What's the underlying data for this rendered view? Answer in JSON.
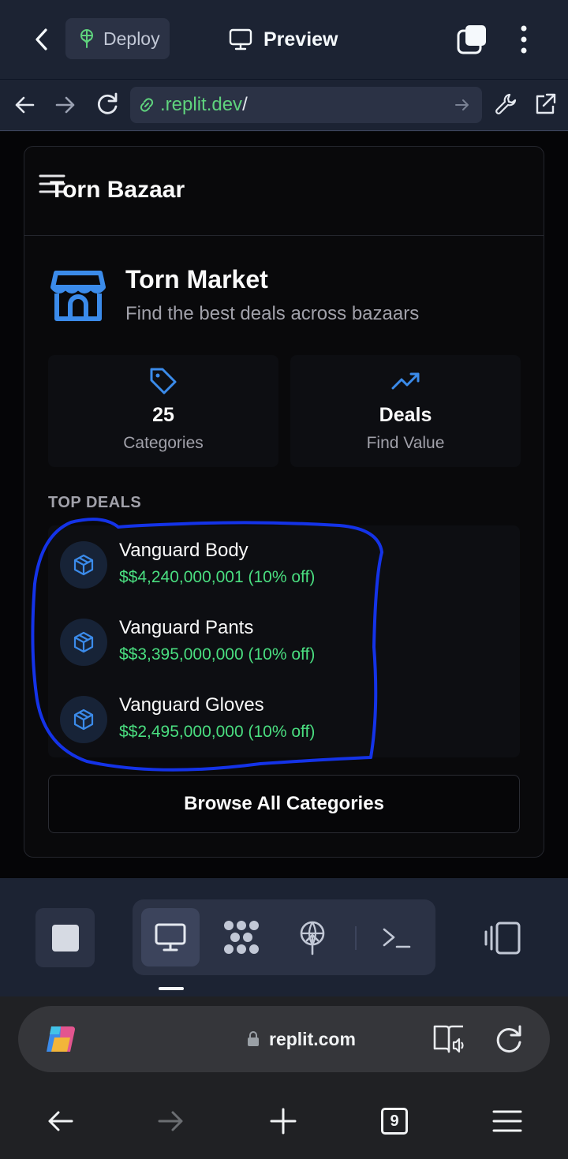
{
  "replit_header": {
    "deploy_label": "Deploy",
    "preview_title": "Preview",
    "url_text": ".replit.dev",
    "url_suffix": "/"
  },
  "app": {
    "site_title": "Torn Bazaar",
    "hero_title": "Torn Market",
    "hero_subtitle": "Find the best deals across bazaars",
    "stats": [
      {
        "value": "25",
        "label": "Categories",
        "icon": "tag-icon"
      },
      {
        "value": "Deals",
        "label": "Find Value",
        "icon": "trending-up-icon"
      }
    ],
    "top_deals_label": "TOP DEALS",
    "deals": [
      {
        "name": "Vanguard Body",
        "price": "$$4,240,000,001 (10% off)",
        "icon": "package-icon"
      },
      {
        "name": "Vanguard Pants",
        "price": "$$3,395,000,000 (10% off)",
        "icon": "package-icon"
      },
      {
        "name": "Vanguard Gloves",
        "price": "$$2,495,000,000 (10% off)",
        "icon": "package-icon"
      }
    ],
    "browse_button": "Browse All Categories"
  },
  "browser": {
    "domain": "replit.com",
    "tab_count": "9"
  },
  "colors": {
    "accent_blue": "#3b8bea",
    "price_green": "#4ade80",
    "annotation_blue": "#1433e8",
    "url_green": "#5fd37d"
  }
}
